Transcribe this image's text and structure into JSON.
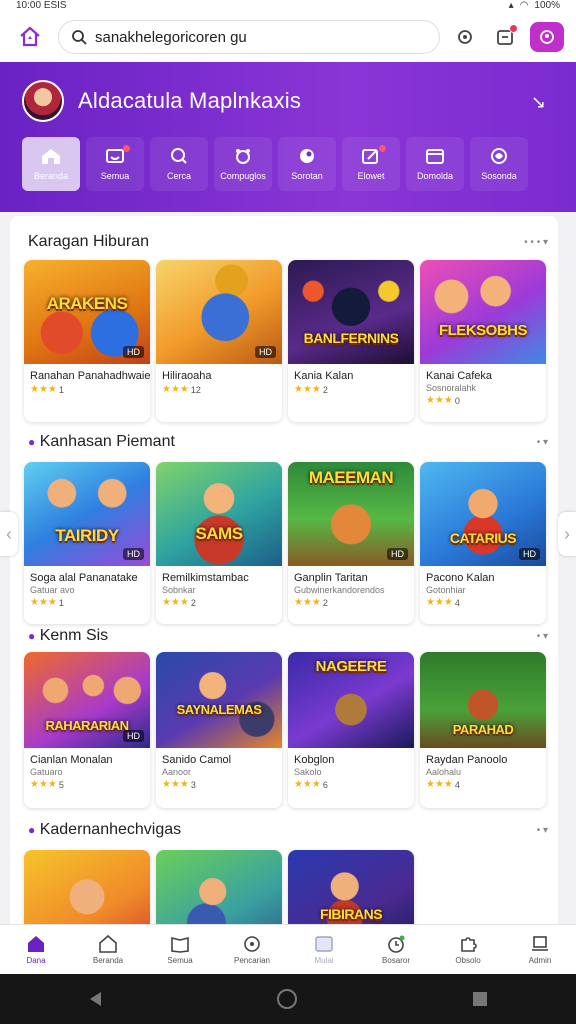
{
  "status": {
    "time": "10:00",
    "extra": "ESIS",
    "battery": "100%"
  },
  "search": {
    "value": "sanakhelegoricoren gu",
    "placeholder": "sanakhelegoricoren gu"
  },
  "header": {
    "title": "Aldacatula Maplnkaxis"
  },
  "categories": [
    {
      "label": "Beranda",
      "icon": "home-icon"
    },
    {
      "label": "Semua",
      "icon": "tv-icon"
    },
    {
      "label": "Cerca",
      "icon": "search-icon"
    },
    {
      "label": "Compuglos",
      "icon": "gamepad-icon"
    },
    {
      "label": "Sorotan",
      "icon": "puzzle-icon"
    },
    {
      "label": "Elowet",
      "icon": "edit-icon"
    },
    {
      "label": "Domolda",
      "icon": "calendar-icon"
    },
    {
      "label": "Sosonda",
      "icon": "globe-icon"
    }
  ],
  "sections": [
    {
      "title": "Karagan Hiburan",
      "more": "• • • ▾",
      "cards": [
        {
          "art": "ARAKENS",
          "tag": "HD",
          "name": "Ranahan Panahadhwaie",
          "sub": "",
          "rating": "1"
        },
        {
          "art": "",
          "tag": "HD",
          "name": "Hiliraoaha",
          "sub": "",
          "rating": "12"
        },
        {
          "art": "BANLFERNINS",
          "tag": "",
          "name": "Kania Kalan",
          "sub": "",
          "rating": "2"
        },
        {
          "art": "FLEKSOBHS",
          "tag": "",
          "name": "Kanai Cafeka",
          "sub": "Sosnoralahk",
          "rating": "0"
        }
      ]
    },
    {
      "title": "Kanhasan Piemant",
      "more": "• ▾",
      "cards": [
        {
          "art": "TAIRIDY",
          "tag": "HD",
          "name": "Soga alal Pananatake",
          "sub": "Gatuar avo",
          "rating": "1"
        },
        {
          "art": "SAMS",
          "tag": "",
          "name": "Remilkimstambac",
          "sub": "Sobnkar",
          "rating": "2"
        },
        {
          "art": "MAEEMAN",
          "tag": "HD",
          "name": "Ganplin Taritan",
          "sub": "Gubwinerkandorendos",
          "rating": "2"
        },
        {
          "art": "CATARIUS",
          "tag": "HD",
          "name": "Pacono Kalan",
          "sub": "Gotonhiar",
          "rating": "4"
        }
      ]
    },
    {
      "title": "Kenm Sis",
      "more": "• ▾",
      "cards": [
        {
          "art": "RAHARARIAN",
          "tag": "HD",
          "name": "Cianlan Monalan",
          "sub": "Gatuaro",
          "rating": "5"
        },
        {
          "art": "SAYNALEMAS",
          "tag": "",
          "name": "Sanido Camol",
          "sub": "Aanoor",
          "rating": "3"
        },
        {
          "art": "NAGEERE",
          "tag": "",
          "name": "Kobglon",
          "sub": "Sakolo",
          "rating": "6"
        },
        {
          "art": "PARAHAD",
          "tag": "",
          "name": "Raydan Panoolo",
          "sub": "Aalohalu",
          "rating": "4"
        }
      ]
    },
    {
      "title": "Kadernanhechvigas",
      "more": "• ▾",
      "cards": [
        {
          "art": "",
          "tag": "",
          "name": "",
          "sub": "",
          "rating": ""
        },
        {
          "art": "",
          "tag": "",
          "name": "",
          "sub": "",
          "rating": ""
        },
        {
          "art": "FIBIRANS",
          "tag": "",
          "name": "",
          "sub": "",
          "rating": ""
        }
      ]
    }
  ],
  "bottom_nav": [
    {
      "label": "Dana",
      "icon": "home-icon"
    },
    {
      "label": "Beranda",
      "icon": "house-outline-icon"
    },
    {
      "label": "Semua",
      "icon": "book-icon"
    },
    {
      "label": "Pencarian",
      "icon": "chat-search-icon"
    },
    {
      "label": "Mulai",
      "icon": "grid-icon"
    },
    {
      "label": "Bosaror",
      "icon": "clock-icon"
    },
    {
      "label": "Obsolo",
      "icon": "puzzle-icon"
    },
    {
      "label": "Admin",
      "icon": "admin-icon"
    }
  ],
  "colors": {
    "brand": "#6a22c4",
    "accent": "#c02fc9",
    "star": "#f3b31b"
  }
}
